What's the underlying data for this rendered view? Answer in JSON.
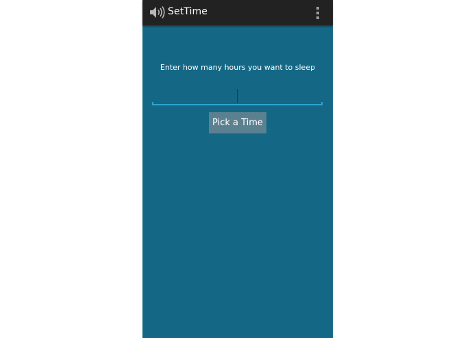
{
  "action_bar": {
    "title": "SetTime",
    "app_icon": "speaker-volume-icon",
    "overflow_icon": "overflow-menu-icon",
    "background": "#222222"
  },
  "main": {
    "background": "#146886",
    "prompt": "Enter how many hours you want to sleep",
    "hours_input": {
      "value": "",
      "placeholder": ""
    },
    "pick_button_label": "Pick a Time",
    "accent": "#2ea4cf"
  }
}
